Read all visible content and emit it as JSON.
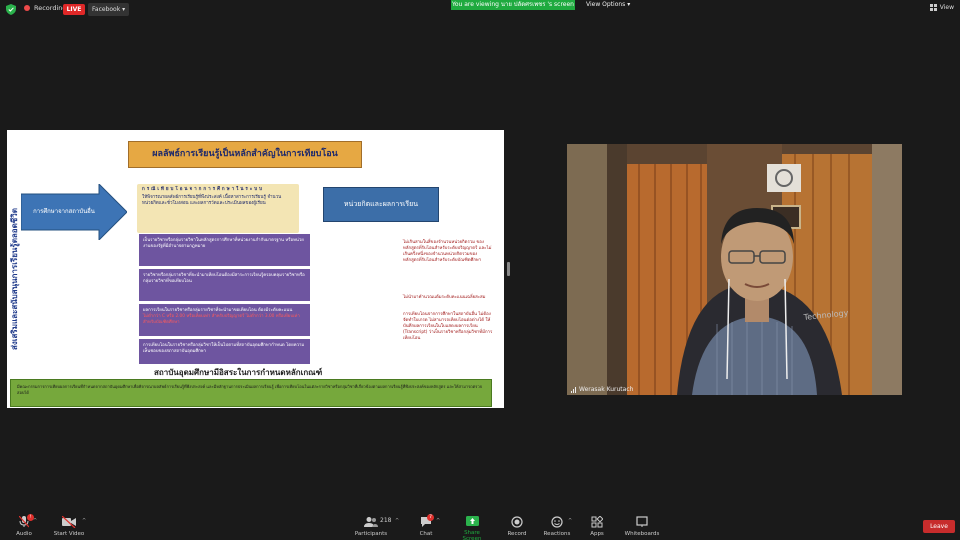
{
  "topbar": {
    "recording_label": "Recording",
    "live_label": "LIVE",
    "facebook_label": "Facebook",
    "viewing_label": "You are viewing นาย ปลัดศรเพชร 's screen",
    "view_options_label": "View Options",
    "view_label": "View"
  },
  "slide": {
    "title": "ผลลัพธ์การเรียนรู้เป็นหลักสำคัญในการเทียบโอน",
    "vertical_text": "ส่งเสริมและสนับสนุนการเรียนรู้ตลอดชีวิต",
    "arrow_label": "การศึกษาจากสถาบันอื่น",
    "yellow_heading": "กรณีเทียบโอนจากการศึกษาในระบบ",
    "yellow_body": "ให้พิจารณาผลลัพธ์การเรียนรู้ที่พึงประสงค์ เนื้อหาสาระการเรียนรู้ จำนวนหน่วยกิตและชั่วโมงสอน และผลการวัดและประเมินผลของผู้เรียน",
    "blue_box_label": "หน่วยกิตและผลการเรียน",
    "purple_1": "เป็นรายวิชาหรือกลุ่มรายวิชาในหลักสูตรการศึกษาที่หน่วยงานกำกับมาตรฐาน หรือหน่วยงานของรัฐที่มีอำนาจตามกฎหมาย",
    "purple_2": "รายวิชาหรือกลุ่มรายวิชาที่จะนำมาเทียบโอนต้องมีสาระการเรียนรู้ครอบคลุมรายวิชาหรือกลุ่มรายวิชาที่ขอเทียบโอน",
    "purple_3a": "ผลการเรียนในรายวิชาหรือกลุ่มรายวิชาที่จะนำมาขอเทียบโอน ต้องมีระดับคะแนน",
    "purple_3b": "ไม่ต่ำกว่า C หรือ 2.00 หรือเทียบเท่า สำหรับปริญญาตรี ไม่ต่ำกว่า 3.00 หรือเทียบเท่า สำหรับบัณฑิตศึกษา",
    "purple_4": "การเทียบโอนในรายวิชาหรือกลุ่มวิชาให้เป็นไปตามที่สถาบันอุดมศึกษากำหนด โดยความเห็นชอบของสภาสถาบันอุดมศึกษา",
    "red_1": "ไม่เกินสามในสี่ของจำนวนหน่วยกิตรวม ของหลักสูตรที่รับโอนสำหรับระดับปริญญาตรี และไม่เกินครึ่งหนึ่งของจำนวนหน่วยกิตรวมของหลักสูตรที่รับโอนสำหรับระดับบัณฑิตศึกษา",
    "red_2": "ไม่นำมาคำนวณแต้มระดับคะแนนเฉลี่ยสะสม",
    "red_3": "การเทียบโอนจากการศึกษาในสถาบันอื่น ไม่ต้องจัดทำใบเกรด ไม่สามารถเทียบโอนต่อต่างได้ ให้บันทึกผลการเรียนในใบแสดงผลการเรียน (Transcript) ว่าเป็นรายวิชาหรือกลุ่มวิชาที่มีการเทียบโอน",
    "institution_label": "สถาบันอุดมศึกษามีอิสระในการกำหนดหลักเกณฑ์",
    "green_band_text": "มีคณะกรรมการการเทียบผลการเรียนที่กำหนดจากสถาบันอุดมศึกษาเพื่อพิจารณาผลลัพธ์การเรียนรู้ที่พึงประสงค์ และมีหลักฐานการประเมินผลการเรียนรู้ เพื่อการเทียบโอนในแต่ละรายวิชาหรือกลุ่มวิชาที่เกี่ยวข้องตามผลการเรียนรู้ที่พึงประสงค์ของหลักสูตร และให้สามารถตรวจสอบได้"
  },
  "camera": {
    "participant_name": "Werasak Kurutach",
    "shirt_text": "Technology"
  },
  "toolbar": {
    "audio_label": "Audio",
    "video_label": "Start Video",
    "participants_label": "Participants",
    "participants_count": "218",
    "chat_label": "Chat",
    "chat_badge": "7",
    "share_label": "Share Screen",
    "record_label": "Record",
    "reactions_label": "Reactions",
    "apps_label": "Apps",
    "whiteboards_label": "Whiteboards",
    "leave_label": "Leave",
    "audio_badge": "!"
  },
  "colors": {
    "share_green": "#1faa3f",
    "live_red": "#e02828",
    "leave_red": "#c72c2c"
  }
}
